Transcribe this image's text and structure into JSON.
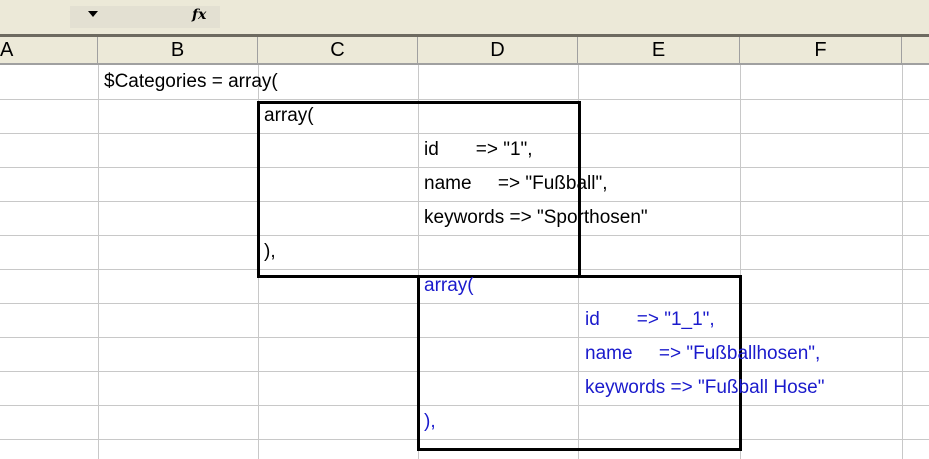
{
  "toolbar": {
    "function_icon": "fx-icon"
  },
  "columns": [
    "A",
    "B",
    "C",
    "D",
    "E",
    "F"
  ],
  "cells": {
    "B1": "$Categories = array(",
    "C2": "array(",
    "D3": "id       => \"1\",",
    "D4": "name     => \"Fußball\",",
    "D5": "keywords => \"Sporthosen\"",
    "C6": "),",
    "D7": "array(",
    "E8": "id       => \"1_1\",",
    "E9": "name     => \"Fußballhosen\",",
    "E10": "keywords => \"Fußball Hose\"",
    "D11": "),"
  },
  "colors": {
    "header_bg": "#ece9d8",
    "gridline": "#c8c8c8",
    "nested_text": "#1a1acc",
    "text": "#000000"
  }
}
